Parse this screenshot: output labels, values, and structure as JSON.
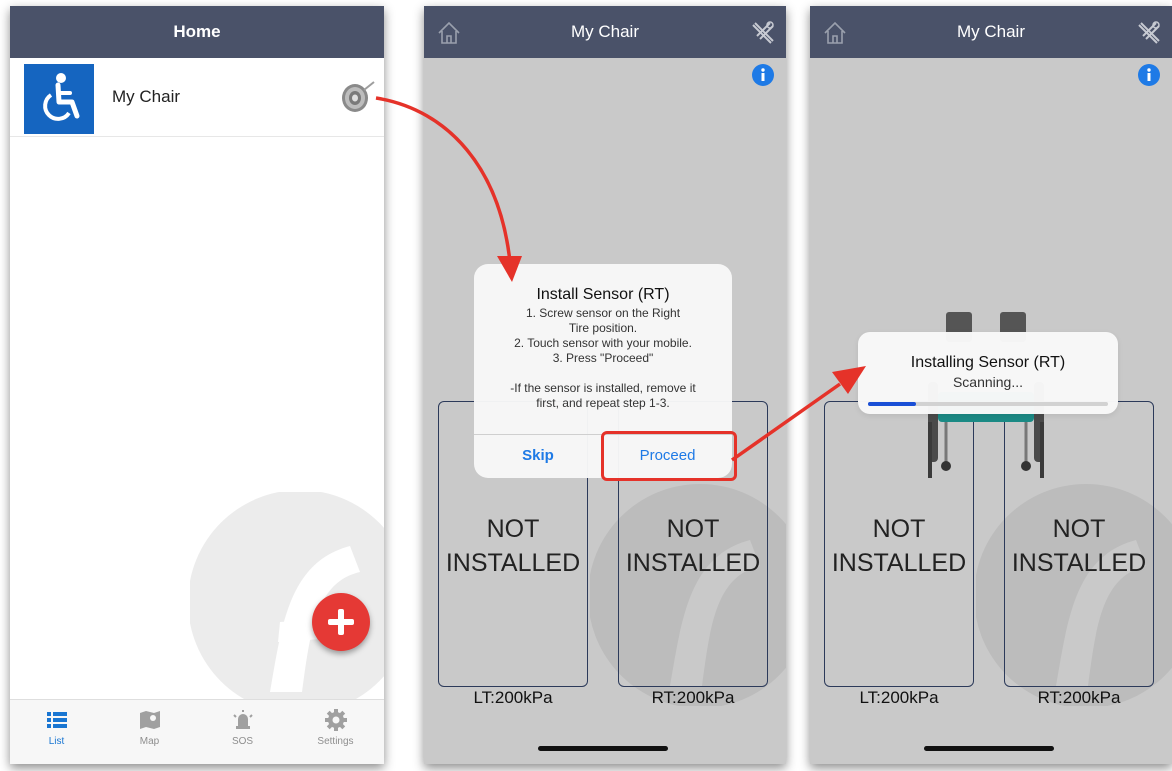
{
  "screen1": {
    "title": "Home",
    "chair": {
      "name": "My Chair",
      "avatar_icon": "wheelchair-icon",
      "action_icon": "tire-sensor-icon"
    },
    "fab_icon": "plus-icon",
    "tabs": [
      {
        "label": "List",
        "icon": "list-icon",
        "active": true
      },
      {
        "label": "Map",
        "icon": "map-icon",
        "active": false
      },
      {
        "label": "SOS",
        "icon": "alarm-icon",
        "active": false
      },
      {
        "label": "Settings",
        "icon": "gear-icon",
        "active": false
      }
    ]
  },
  "screen2": {
    "title": "My Chair",
    "dialog": {
      "title": "Install Sensor (RT)",
      "lines": [
        "1. Screw sensor on the Right",
        "Tire position.",
        "2. Touch sensor with your mobile.",
        "3. Press \"Proceed\"",
        "",
        "-If the sensor is installed, remove it",
        "first, and repeat step 1-3."
      ],
      "skip_label": "Skip",
      "proceed_label": "Proceed"
    },
    "tires": [
      {
        "status_line1": "NOT",
        "status_line2": "INSTALLED",
        "pressure": "LT:200kPa"
      },
      {
        "status_line1": "NOT",
        "status_line2": "INSTALLED",
        "pressure": "RT:200kPa"
      }
    ]
  },
  "screen3": {
    "title": "My Chair",
    "progress": {
      "title": "Installing Sensor (RT)",
      "subtitle": "Scanning...",
      "fraction": 0.2
    },
    "tires": [
      {
        "status_line1": "NOT",
        "status_line2": "INSTALLED",
        "pressure": "LT:200kPa"
      },
      {
        "status_line1": "NOT",
        "status_line2": "INSTALLED",
        "pressure": "RT:200kPa"
      }
    ]
  },
  "colors": {
    "navbar": "#4a5269",
    "accent_blue": "#1e7ae6",
    "avatar_blue": "#1565c0",
    "fab_red": "#e53935",
    "annotation_red": "#e53229",
    "screen_gray": "#c9c9c9"
  }
}
